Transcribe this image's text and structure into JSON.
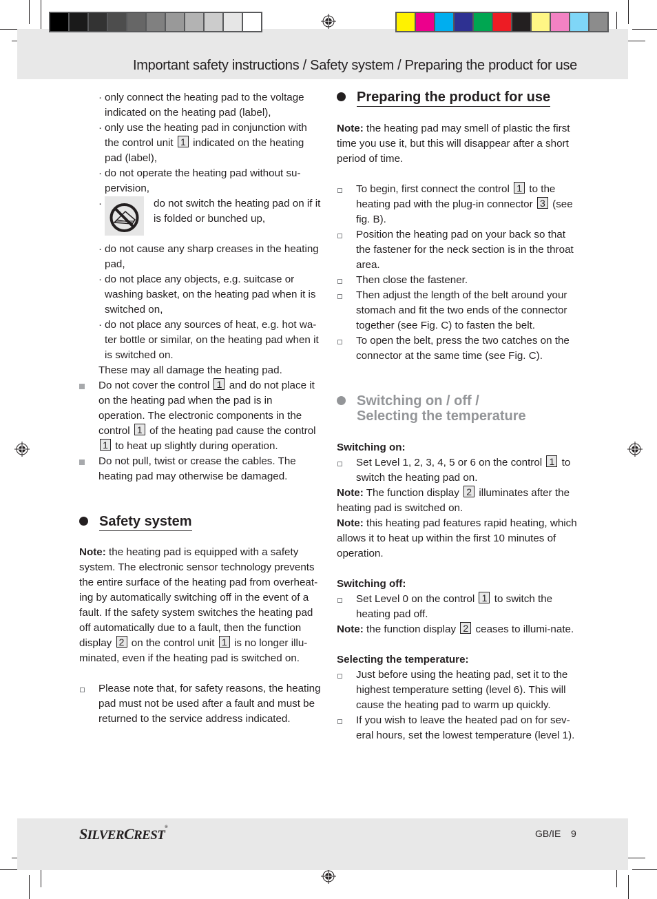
{
  "header": {
    "title": "Important safety instructions / Safety system / Preparing the product for use"
  },
  "print_marks": {
    "grey_swatches": [
      "#000000",
      "#1a1a1a",
      "#333333",
      "#4d4d4d",
      "#666666",
      "#808080",
      "#999999",
      "#b3b3b3",
      "#cccccc",
      "#e6e6e6",
      "#ffffff"
    ],
    "color_swatches": [
      "#fff200",
      "#ec008c",
      "#00aeef",
      "#2e3192",
      "#00a651",
      "#ed1c24",
      "#231f20",
      "#fff685",
      "#f282c3",
      "#7fd6f7",
      "#8c8c8c"
    ]
  },
  "left_column": {
    "dot_items": [
      {
        "text": "only connect the heating pad to the voltage indicated on the heating pad (label),"
      },
      {
        "before": "only use the heating pad in conjunction with the control unit",
        "ref": "1",
        "after": "indicated on the heating pad (label),"
      },
      {
        "text": "do not operate the heating pad without su-pervision,"
      },
      {
        "text": "do not switch the heating pad on if it is folded or bunched up,",
        "icon": "no-folding-icon"
      },
      {
        "text": "do not cause any sharp creases in the heating pad,"
      },
      {
        "text": "do not place any objects, e.g. suitcase or washing basket, on the heating pad when it is switched on,"
      },
      {
        "text": "do not place any sources of heat, e.g. hot wa-ter bottle or similar, on the heating pad when it is switched on."
      }
    ],
    "summary": "These may all damage the heating pad.",
    "square_items": [
      {
        "parts": [
          "Do not cover the control",
          "1",
          "and do not place it on the heating pad when the pad is in operation. The electronic components in the control",
          "1",
          "of the heating pad cause the control",
          "1",
          "to heat up slightly during operation."
        ]
      },
      {
        "parts": [
          "Do not pull, twist or crease the cables. The heating pad may otherwise be damaged."
        ]
      }
    ],
    "safety_system": {
      "heading": "Safety system",
      "note_label": "Note:",
      "note_parts": [
        "the heating pad is equipped with a safety system. The electronic sensor technology prevents the entire surface of the heating pad from overheat-ing by automatically switching off in the event of a fault. If the safety system switches the heating pad off automatically due to a fault, then the function display",
        "2",
        "on the control unit",
        "1",
        "is no longer illu-minated, even if the heating pad is switched on."
      ],
      "checkbox_item": "Please note that, for safety reasons, the heating pad must not be used after a fault and must be returned to the service address indicated."
    }
  },
  "right_column": {
    "preparing": {
      "heading": "Preparing the product for use",
      "note_label": "Note:",
      "note": "the heating pad may smell of plastic the first time you use it, but this will disappear after a short period of time.",
      "items": [
        {
          "parts": [
            "To begin, first connect the control",
            "1",
            "to the heating pad with the plug-in connector",
            "3",
            "(see fig. B)."
          ]
        },
        {
          "parts": [
            "Position the heating pad on your back so that the fastener for the neck section is in the throat area."
          ]
        },
        {
          "parts": [
            "Then close the fastener."
          ]
        },
        {
          "parts": [
            "Then adjust the length of the belt around your stomach and fit the two ends of the connector together (see Fig. C) to fasten the belt."
          ]
        },
        {
          "parts": [
            "To open the belt, press the two catches on the connector at the same time (see Fig. C)."
          ]
        }
      ]
    },
    "switching": {
      "heading_line1": "Switching on / off /",
      "heading_line2": "Selecting the temperature",
      "on": {
        "label": "Switching on:",
        "item_parts": [
          "Set Level 1, 2, 3, 4, 5 or 6 on the control",
          "1",
          "to switch the heating pad on."
        ],
        "note1_label": "Note:",
        "note1_parts": [
          "The function display",
          "2",
          "illuminates after the heating pad is switched on."
        ],
        "note2_label": "Note:",
        "note2": "this heating pad features rapid heating, which allows it to heat up within the first 10 minutes of operation."
      },
      "off": {
        "label": "Switching off:",
        "item_parts": [
          "Set Level 0 on the control",
          "1",
          "to switch the heating pad off."
        ],
        "note_label": "Note:",
        "note_parts": [
          "the function display",
          "2",
          "ceases to illumi-nate."
        ]
      },
      "temperature": {
        "label": "Selecting the temperature:",
        "items": [
          "Just before using the heating pad, set it to the highest temperature setting (level 6). This will cause the heating pad to warm up quickly.",
          "If you wish to leave the heated pad on for sev-eral hours, set the lowest temperature (level 1)."
        ]
      }
    }
  },
  "footer": {
    "brand_first": "S",
    "brand_ilver": "ILVER",
    "brand_c": "C",
    "brand_rest": "REST",
    "registered": "®",
    "lang": "GB/IE",
    "page": "9"
  }
}
